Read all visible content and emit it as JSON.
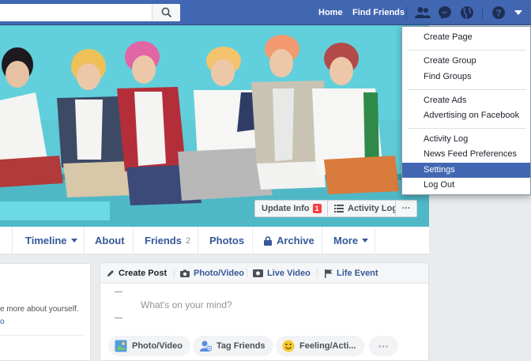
{
  "topbar": {
    "home": "Home",
    "find_friends": "Find Friends"
  },
  "profile": {
    "buttons": {
      "update_info": "Update Info",
      "update_info_badge": "1",
      "activity_log": "Activity Log",
      "more": "···"
    },
    "tabs": [
      {
        "label": "Timeline"
      },
      {
        "label": "About"
      },
      {
        "label": "Friends",
        "count": "2"
      },
      {
        "label": "Photos"
      },
      {
        "label": "Archive"
      },
      {
        "label": "More"
      }
    ]
  },
  "intro": {
    "text": "e more about yourself.",
    "link": "o"
  },
  "composer": {
    "tabs": [
      {
        "label": "Create Post"
      },
      {
        "label": "Photo/Video"
      },
      {
        "label": "Live Video"
      },
      {
        "label": "Life Event"
      }
    ],
    "placeholder": "What's on your mind?",
    "actions": [
      {
        "label": "Photo/Video"
      },
      {
        "label": "Tag Friends"
      },
      {
        "label": "Feeling/Acti..."
      },
      {
        "label": "···"
      }
    ]
  },
  "menu": {
    "items": [
      "Create Page",
      "Create Group",
      "Find Groups",
      "Create Ads",
      "Advertising on Facebook",
      "Activity Log",
      "News Feed Preferences",
      "Settings",
      "Log Out"
    ],
    "active": "Settings"
  },
  "colors": {
    "brand": "#4267b2",
    "cover_bg": "#5ccad8",
    "badge": "#fa3e3e"
  }
}
